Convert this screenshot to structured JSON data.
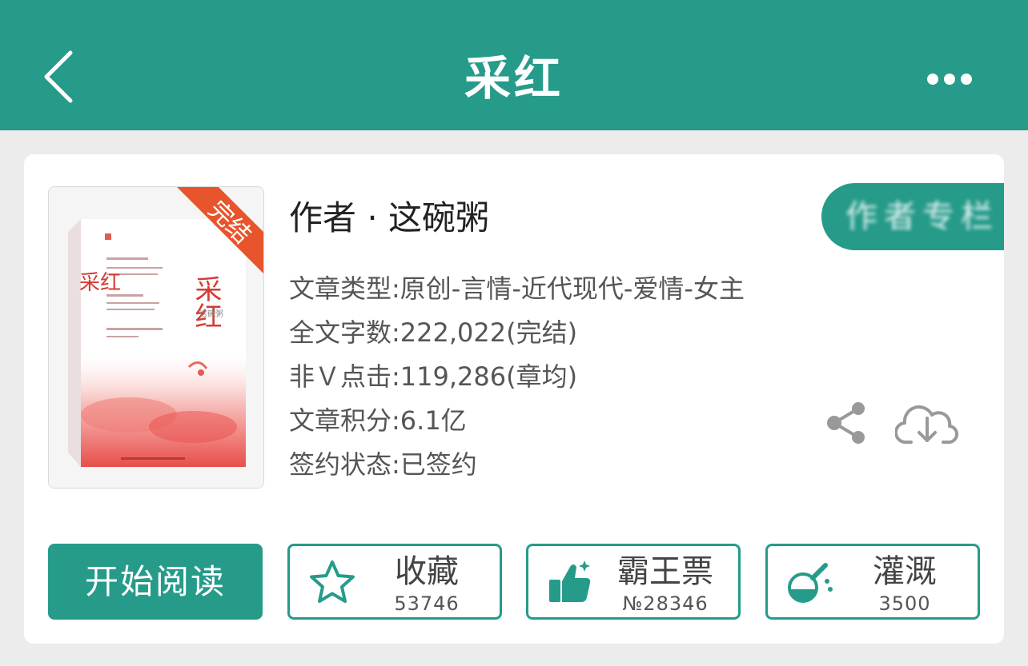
{
  "header": {
    "title": "采红",
    "back_icon": "chevron-left-icon",
    "more_icon": "more-dots-icon"
  },
  "book": {
    "cover": {
      "title": "采红",
      "badge": "完结",
      "side_title": "采红",
      "author_small": "这碗粥",
      "badge_color": "#e8542b"
    },
    "author_line": "作者 · 这碗粥",
    "author_tab_label": "作者专栏",
    "info": [
      "文章类型:原创-言情-近代现代-爱情-女主",
      "全文字数:222,022(完结)",
      "非Ｖ点击:119,286(章均)",
      "文章积分:6.1亿",
      "签约状态:已签约"
    ]
  },
  "icons": {
    "share": "share-icon",
    "download": "cloud-download-icon"
  },
  "actions": {
    "read_label": "开始阅读",
    "favorite": {
      "label": "收藏",
      "count": "53746",
      "icon": "star-icon"
    },
    "ticket": {
      "label": "霸王票",
      "count": "№28346",
      "icon": "thumbs-up-icon"
    },
    "irrigate": {
      "label": "灌溉",
      "count": "3500",
      "icon": "flask-icon"
    }
  },
  "colors": {
    "accent": "#269b8a",
    "background": "#ececec",
    "card": "#ffffff",
    "text": "#555555",
    "icon_gray": "#999999"
  }
}
